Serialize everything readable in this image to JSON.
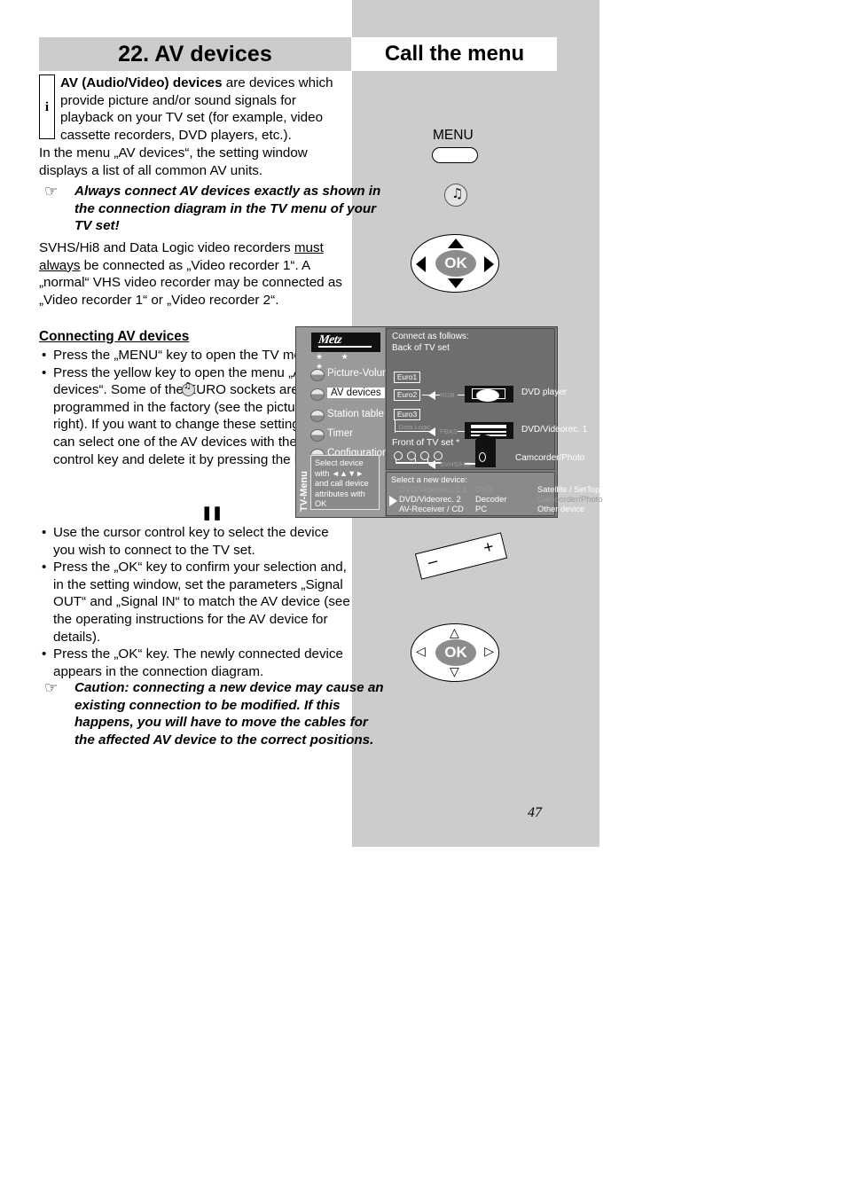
{
  "chapter": {
    "title": "22. AV devices"
  },
  "section": {
    "title": "Call the menu"
  },
  "info": {
    "icon": "i",
    "bold_lead": "AV (Audio/Video) devices",
    "rest": " are devices which provide picture and/or sound signals for playback on your TV set (for example, video cassette recorders, DVD players, etc.)."
  },
  "intro": "In the menu „AV devices“, the setting window displays a list of all common AV units.",
  "note1": "Always connect AV devices exactly as shown in the connection diagram in the TV menu of your TV set!",
  "para2_a": "SVHS/Hi8 and Data Logic video recorders ",
  "para2_must": "must always",
  "para2_b": " be connected as „Video recorder 1“. A „normal“ VHS video recorder may be connected as „Video recorder 1“ or „Video recorder 2“.",
  "subhead": "Connecting AV devices",
  "bullets": [
    "Press the „MENU“ key to open the TV menu.",
    "Press the yellow key  to open the menu „AV devices“. Some of the EURO sockets are pre-programmed in the factory (see the picture on the right). If you want to change these settings, you can select one of the AV devices with the cursor control key and delete it by pressing the  key.",
    "Use the cursor control key to select the device you wish to connect to the TV set.",
    "Press the „OK“ key to confirm your selection and, in the setting window, set the parameters „Signal OUT“ and „Signal IN“ to match the AV device (see the operating instructions for the AV device for details).",
    "Press the „OK“ key. The newly connected device appears in the connection diagram."
  ],
  "note2": "Caution: connecting a new device may cause an existing connection to be modified. If this happens, you will have to move the cables for the affected AV device to the correct positions.",
  "remote": {
    "menu_label": "MENU",
    "ok_label": "OK",
    "plus": "+",
    "minus": "–"
  },
  "tvmenu": {
    "vertical_label": "TV-Menu",
    "brand": "Metz",
    "stars": "★ ★ ★",
    "items": [
      {
        "label": "Picture-Volume",
        "selected": false
      },
      {
        "label": "AV devices",
        "selected": true
      },
      {
        "label": "Station table",
        "selected": false
      },
      {
        "label": "Timer",
        "selected": false
      },
      {
        "label": "Configuration",
        "selected": false
      }
    ],
    "help": "Select device with ◄▲▼► and call device attributes with OK",
    "diagram": {
      "title": "Connect as follows:",
      "subtitle": "Back of TV set",
      "euro1": "Euro1",
      "euro2": "Euro2",
      "euro3": "Euro3",
      "datalogic": "Data Logic",
      "sig_rgb": "RGB",
      "sig_fbas": "FBAS",
      "sig_svhs": "SVHS/Hi8",
      "dev_dvd": "DVD player",
      "dev_rec": "DVD/Videorec. 1",
      "dev_cam": "Camcorder/Photo",
      "front": "Front of TV set *"
    },
    "select": {
      "header": "Select a new device:",
      "rows": [
        {
          "c1": "DVD/Videorec. 1 1",
          "c1dim": true,
          "c2": "DVD",
          "c2dim": true,
          "c3": "Satellite / SetTop",
          "c3dim": false
        },
        {
          "c1": "DVD/Videorec. 2",
          "c1dim": false,
          "c2": "Decoder",
          "c2dim": false,
          "c3": "Camcorder/Photo",
          "c3dim": true
        },
        {
          "c1": "AV-Receiver / CD",
          "c1dim": false,
          "c2": "PC",
          "c2dim": false,
          "c3": "Other device",
          "c3dim": false
        }
      ]
    }
  },
  "page_number": "47"
}
